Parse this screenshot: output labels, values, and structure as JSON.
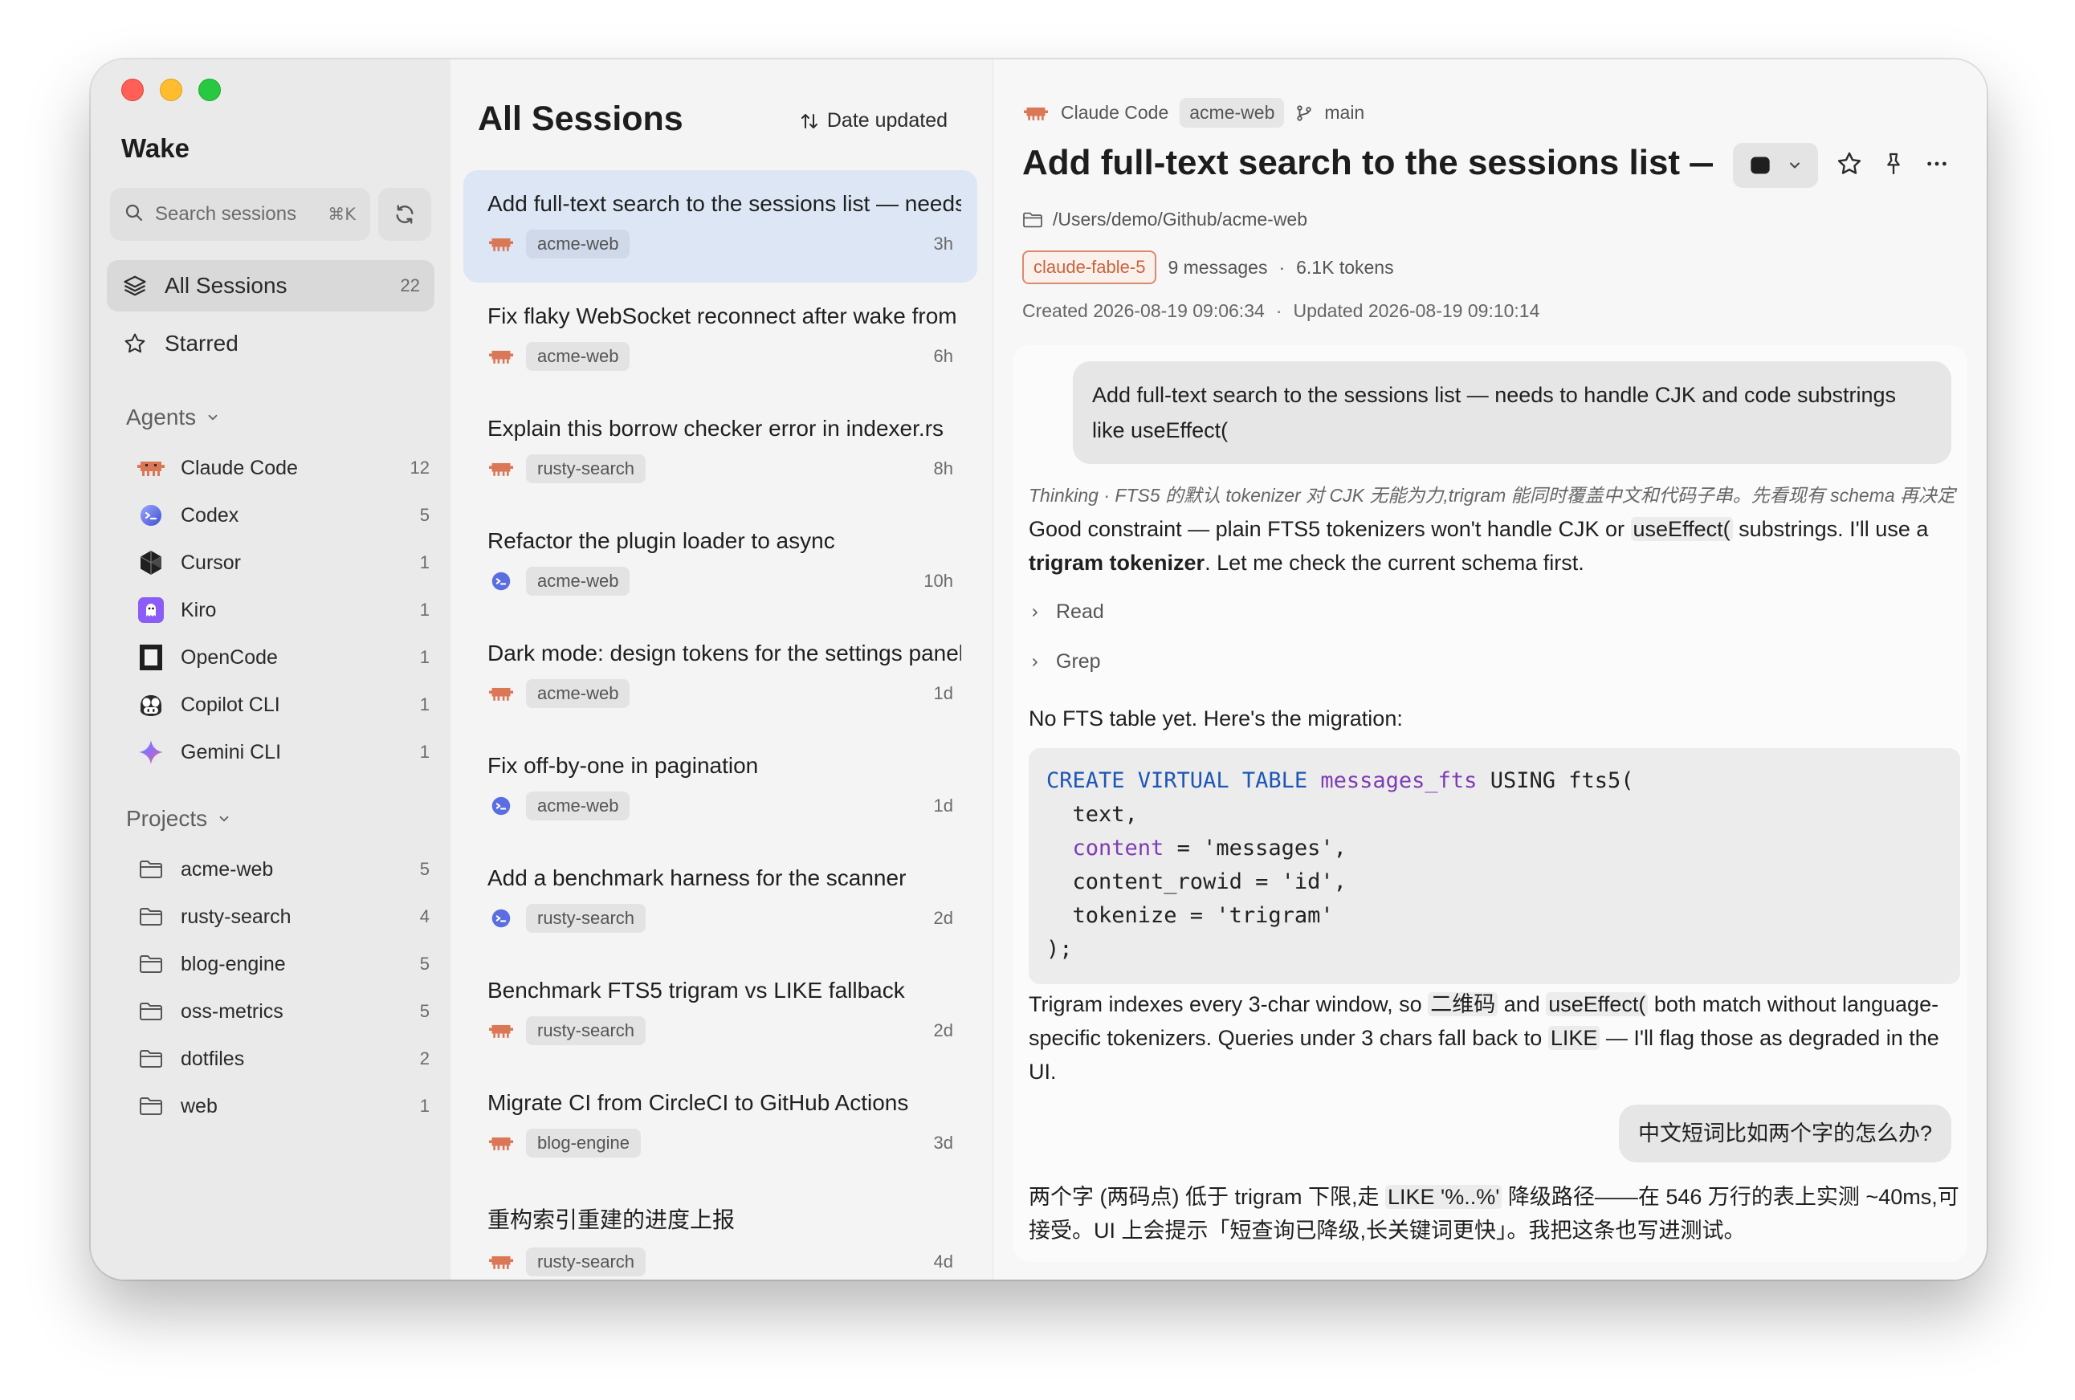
{
  "app": {
    "name": "Wake"
  },
  "sidebar": {
    "search_placeholder": "Search sessions",
    "search_shortcut": "⌘K",
    "nav": [
      {
        "label": "All Sessions",
        "count": "22"
      },
      {
        "label": "Starred",
        "count": ""
      }
    ],
    "agents_header": "Agents",
    "agents": [
      {
        "label": "Claude Code",
        "count": "12"
      },
      {
        "label": "Codex",
        "count": "5"
      },
      {
        "label": "Cursor",
        "count": "1"
      },
      {
        "label": "Kiro",
        "count": "1"
      },
      {
        "label": "OpenCode",
        "count": "1"
      },
      {
        "label": "Copilot CLI",
        "count": "1"
      },
      {
        "label": "Gemini CLI",
        "count": "1"
      }
    ],
    "projects_header": "Projects",
    "projects": [
      {
        "label": "acme-web",
        "count": "5"
      },
      {
        "label": "rusty-search",
        "count": "4"
      },
      {
        "label": "blog-engine",
        "count": "5"
      },
      {
        "label": "oss-metrics",
        "count": "5"
      },
      {
        "label": "dotfiles",
        "count": "2"
      },
      {
        "label": "web",
        "count": "1"
      }
    ]
  },
  "sessions": {
    "title": "All Sessions",
    "sort_label": "Date updated",
    "items": [
      {
        "title": "Add full-text search to the sessions list — needs to handle CJK",
        "project": "acme-web",
        "time": "3h"
      },
      {
        "title": "Fix flaky WebSocket reconnect after wake from sleep",
        "project": "acme-web",
        "time": "6h"
      },
      {
        "title": "Explain this borrow checker error in indexer.rs",
        "project": "rusty-search",
        "time": "8h"
      },
      {
        "title": "Refactor the plugin loader to async",
        "project": "acme-web",
        "time": "10h"
      },
      {
        "title": "Dark mode: design tokens for the settings panel",
        "project": "acme-web",
        "time": "1d"
      },
      {
        "title": "Fix off-by-one in pagination",
        "project": "acme-web",
        "time": "1d"
      },
      {
        "title": "Add a benchmark harness for the scanner",
        "project": "rusty-search",
        "time": "2d"
      },
      {
        "title": "Benchmark FTS5 trigram vs LIKE fallback",
        "project": "rusty-search",
        "time": "2d"
      },
      {
        "title": "Migrate CI from CircleCI to GitHub Actions",
        "project": "blog-engine",
        "time": "3d"
      },
      {
        "title": "重构索引重建的进度上报",
        "project": "rusty-search",
        "time": "4d"
      }
    ]
  },
  "detail": {
    "agent": "Claude Code",
    "project": "acme-web",
    "branch": "main",
    "title": "Add full-text search to the sessions list — needs to handle CJK",
    "path": "/Users/demo/Github/acme-web",
    "model": "claude-fable-5",
    "messages": "9 messages",
    "separator": "·",
    "tokens": "6.1K tokens",
    "created": "Created 2026-08-19 09:06:34",
    "updated": "Updated 2026-08-19 09:10:14",
    "conversation": {
      "user_1": "Add full-text search to the sessions list — needs to handle CJK and code substrings like useEffect(",
      "thinking_label": "Thinking",
      "thinking_sep": " · ",
      "thinking_text": "FTS5 的默认 tokenizer 对 CJK 无能为力,trigram 能同时覆盖中文和代码子串。先看现有 schema 再决定",
      "reply_1_a": "Good constraint — plain FTS5 tokenizers won't handle CJK or ",
      "reply_1_code": "useEffect(",
      "reply_1_b": " substrings. I'll use a ",
      "reply_1_bold": "trigram tokenizer",
      "reply_1_c": ". Let me check the current schema first.",
      "tool_1": "Read",
      "tool_2": "Grep",
      "reply_2": "No FTS table yet. Here's the migration:",
      "code": {
        "l1_kw": "CREATE VIRTUAL TABLE",
        "l1_name": "messages_fts",
        "l1_rest": " USING fts5(",
        "l2": "  text,",
        "l3_kw": "content",
        "l3_rest": " = 'messages',",
        "l4": "  content_rowid = 'id',",
        "l5": "  tokenize = 'trigram'",
        "l6": ");"
      },
      "reply_3_a": "Trigram indexes every 3-char window, so ",
      "reply_3_code1": "二维码",
      "reply_3_b": " and ",
      "reply_3_code2": "useEffect(",
      "reply_3_c": " both match without language-specific tokenizers. Queries under 3 chars fall back to ",
      "reply_3_code3": "LIKE",
      "reply_3_d": " — I'll flag those as degraded in the UI.",
      "user_2": "中文短词比如两个字的怎么办?",
      "reply_4_a": "两个字 (两码点) 低于 trigram 下限,走 ",
      "reply_4_code": "LIKE '%..%'",
      "reply_4_b": " 降级路径——在 546 万行的表上实测 ~40ms,可接受。UI 上会提示「短查询已降级,长关键词更快」。我把这条也写进测试。"
    }
  },
  "colors": {
    "claude": "#d97757",
    "codex": "#5b6ee1",
    "kiro": "#8b5cf6",
    "accent_selected": "#dce6f4"
  }
}
